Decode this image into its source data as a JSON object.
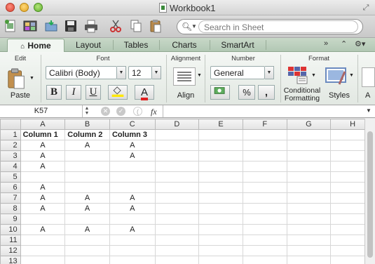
{
  "window": {
    "title": "Workbook1"
  },
  "toolbar": {
    "search_placeholder": "Search in Sheet"
  },
  "tabs": [
    "Home",
    "Layout",
    "Tables",
    "Charts",
    "SmartArt"
  ],
  "ribbon": {
    "groups": {
      "edit": "Edit",
      "font": "Font",
      "alignment": "Alignment",
      "number": "Number",
      "format": "Format"
    },
    "paste_label": "Paste",
    "font_name": "Calibri (Body)",
    "font_size": "12",
    "bold": "B",
    "italic": "I",
    "underline": "U",
    "font_color_letter": "A",
    "align_label": "Align",
    "number_format": "General",
    "percent": "%",
    "comma": ",",
    "conditional_line1": "Conditional",
    "conditional_line2": "Formatting",
    "styles_label": "Styles",
    "cut_off_label": "A"
  },
  "formula_bar": {
    "name_box": "K57",
    "fx": "fx"
  },
  "grid": {
    "columns": [
      "A",
      "B",
      "C",
      "D",
      "E",
      "F",
      "G",
      "H"
    ],
    "rows": [
      "1",
      "2",
      "3",
      "4",
      "5",
      "6",
      "7",
      "8",
      "9",
      "10",
      "11",
      "12",
      "13"
    ],
    "cells": [
      [
        "Column 1",
        "Column 2",
        "Column 3",
        "",
        "",
        "",
        "",
        ""
      ],
      [
        "A",
        "A",
        "A",
        "",
        "",
        "",
        "",
        ""
      ],
      [
        "A",
        "",
        "A",
        "",
        "",
        "",
        "",
        ""
      ],
      [
        "A",
        "",
        "",
        "",
        "",
        "",
        "",
        ""
      ],
      [
        "",
        "",
        "",
        "",
        "",
        "",
        "",
        ""
      ],
      [
        "A",
        "",
        "",
        "",
        "",
        "",
        "",
        ""
      ],
      [
        "A",
        "A",
        "A",
        "",
        "",
        "",
        "",
        ""
      ],
      [
        "A",
        "A",
        "A",
        "",
        "",
        "",
        "",
        ""
      ],
      [
        "",
        "",
        "",
        "",
        "",
        "",
        "",
        ""
      ],
      [
        "A",
        "A",
        "A",
        "",
        "",
        "",
        "",
        ""
      ],
      [
        "",
        "",
        "",
        "",
        "",
        "",
        "",
        ""
      ],
      [
        "",
        "",
        "",
        "",
        "",
        "",
        "",
        ""
      ],
      [
        "",
        "",
        "",
        "",
        "",
        "",
        "",
        ""
      ]
    ]
  },
  "colors": {
    "ribbon_tab_bg": "#b2c8b4",
    "font_color_bar": "#e02020",
    "fill_color_bar": "#ffe800"
  }
}
